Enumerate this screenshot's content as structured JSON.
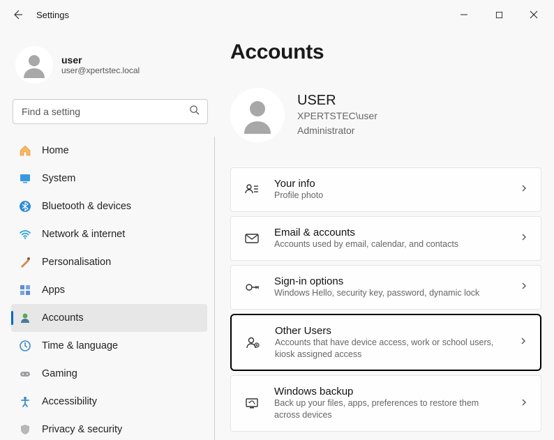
{
  "titlebar": {
    "title": "Settings"
  },
  "profile": {
    "name": "user",
    "email": "user@xpertstec.local"
  },
  "search": {
    "placeholder": "Find a setting"
  },
  "nav": {
    "items": [
      {
        "label": "Home"
      },
      {
        "label": "System"
      },
      {
        "label": "Bluetooth & devices"
      },
      {
        "label": "Network & internet"
      },
      {
        "label": "Personalisation"
      },
      {
        "label": "Apps"
      },
      {
        "label": "Accounts"
      },
      {
        "label": "Time & language"
      },
      {
        "label": "Gaming"
      },
      {
        "label": "Accessibility"
      },
      {
        "label": "Privacy & security"
      }
    ]
  },
  "page": {
    "title": "Accounts",
    "user": {
      "name": "USER",
      "domain": "XPERTSTEC\\user",
      "role": "Administrator"
    },
    "cards": [
      {
        "title": "Your info",
        "sub": "Profile photo"
      },
      {
        "title": "Email & accounts",
        "sub": "Accounts used by email, calendar, and contacts"
      },
      {
        "title": "Sign-in options",
        "sub": "Windows Hello, security key, password, dynamic lock"
      },
      {
        "title": "Other Users",
        "sub": "Accounts that have device access, work or school users, kiosk assigned access"
      },
      {
        "title": "Windows backup",
        "sub": "Back up your files, apps, preferences to restore them across devices"
      }
    ]
  }
}
